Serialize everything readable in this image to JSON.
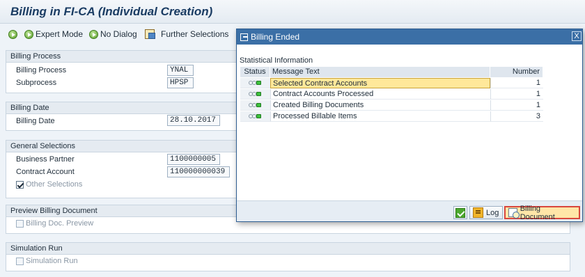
{
  "title": "Billing in FI-CA (Individual Creation)",
  "toolbar": {
    "expert_mode": "Expert Mode",
    "no_dialog": "No Dialog",
    "further_selections": "Further Selections"
  },
  "billing_process": {
    "header": "Billing Process",
    "process_label": "Billing Process",
    "process_value": "YNAL",
    "subprocess_label": "Subprocess",
    "subprocess_value": "HPSP"
  },
  "billing_date": {
    "header": "Billing Date",
    "label": "Billing Date",
    "value": "28.10.2017"
  },
  "general_selections": {
    "header": "General Selections",
    "bp_label": "Business Partner",
    "bp_value": "1100000005",
    "ca_label": "Contract Account",
    "ca_value": "110000000039",
    "other_label": "Other Selections",
    "other_checked": true
  },
  "preview": {
    "header": "Preview Billing Document",
    "checkbox_label": "Billing Doc. Preview",
    "checked": false
  },
  "simulation": {
    "header": "Simulation Run",
    "checkbox_label": "Simulation Run",
    "checked": false
  },
  "dialog": {
    "title": "Billing Ended",
    "close_label": "X",
    "section_label": "Statistical Information",
    "columns": {
      "status": "Status",
      "message": "Message Text",
      "number": "Number"
    },
    "rows": [
      {
        "status": "green",
        "message": "Selected Contract Accounts",
        "number": "1"
      },
      {
        "status": "green",
        "message": "Contract Accounts Processed",
        "number": "1"
      },
      {
        "status": "green",
        "message": "Created Billing Documents",
        "number": "1"
      },
      {
        "status": "green",
        "message": "Processed Billable Items",
        "number": "3"
      }
    ],
    "buttons": {
      "log": "Log",
      "billing_document": "Billing Document"
    }
  }
}
